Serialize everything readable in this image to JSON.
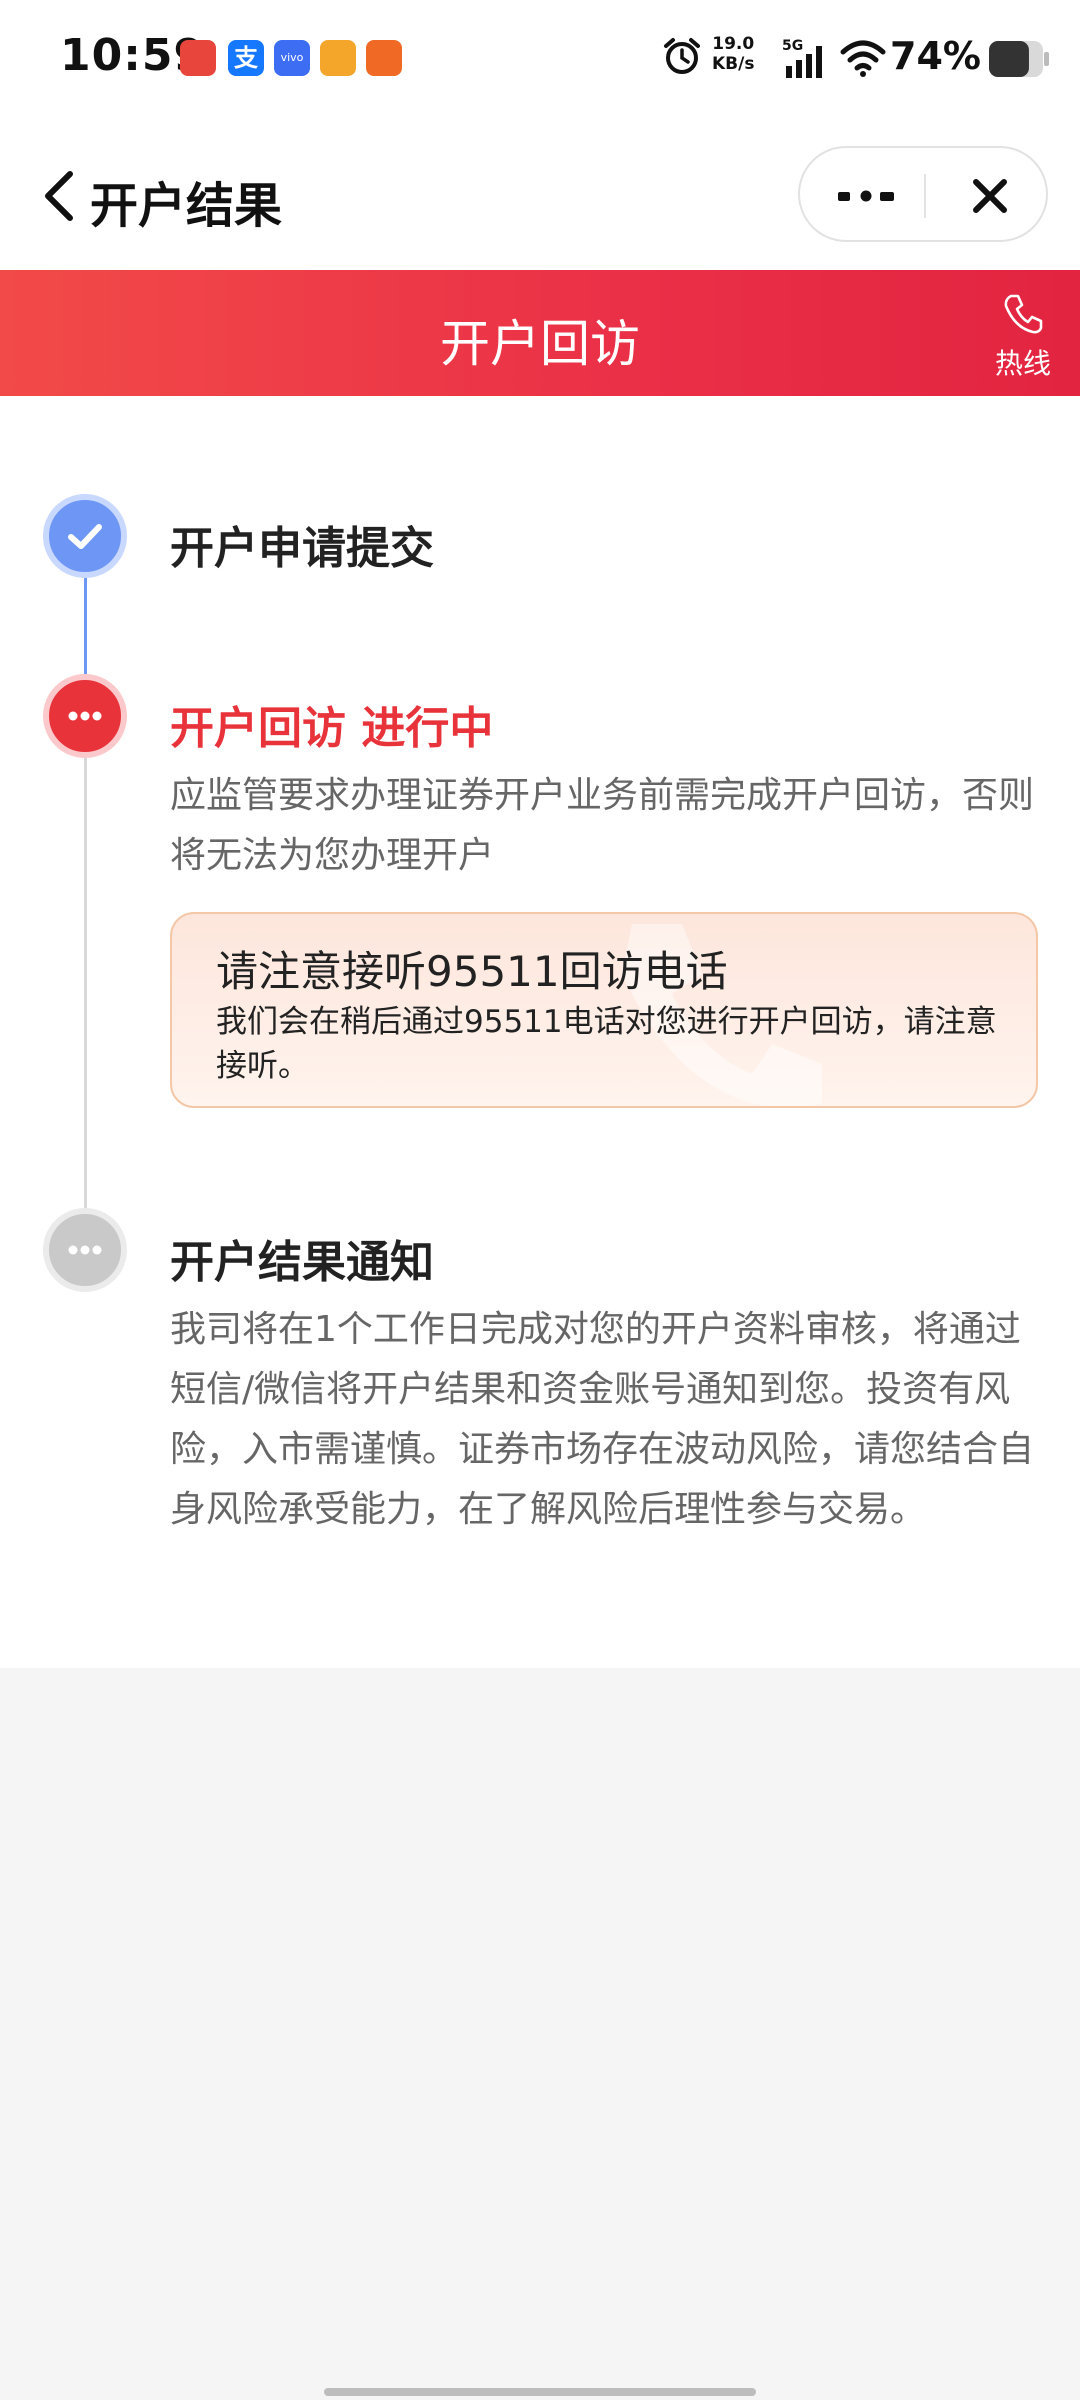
{
  "status_bar": {
    "time": "10:59",
    "app_icons": [
      "red-mascot-app-icon",
      "alipay-icon",
      "vivo-icon",
      "mascot-app-icon",
      "orange-app-icon"
    ],
    "alipay_glyph": "支",
    "vivo_label": "vivo",
    "net_speed_value": "19.0",
    "net_speed_unit": "KB/s",
    "network_type": "5G",
    "battery_percent": "74%",
    "battery_level": 0.74
  },
  "nav": {
    "title": "开户结果"
  },
  "banner": {
    "title": "开户回访",
    "hotline_label": "热线",
    "color_start": "#f24a48",
    "color_end": "#e22440"
  },
  "timeline": {
    "steps": [
      {
        "title": "开户申请提交",
        "state": "done",
        "color": "#6d96f5"
      },
      {
        "title": "开户回访 进行中",
        "state": "active",
        "color": "#e8333b",
        "desc": "应监管要求办理证券开户业务前需完成开户回访，否则将无法为您办理开户",
        "notice": {
          "title": "请注意接听95511回访电话",
          "text": "我们会在稍后通过95511电话对您进行开户回访，请注意接听。"
        }
      },
      {
        "title": "开户结果通知",
        "state": "pending",
        "color": "#c9c9c9",
        "desc": "我司将在1个工作日完成对您的开户资料审核，将通过短信/微信将开户结果和资金账号通知到您。投资有风险，入市需谨慎。证券市场存在波动风险，请您结合自身风险承受能力，在了解风险后理性参与交易。"
      }
    ]
  }
}
